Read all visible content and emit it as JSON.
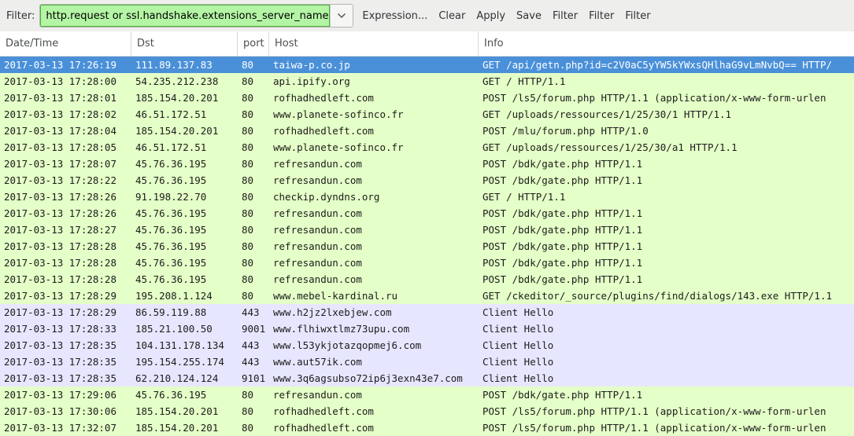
{
  "toolbar": {
    "filter_label": "Filter:",
    "filter_value": "http.request or ssl.handshake.extensions_server_name",
    "buttons": [
      "Expression...",
      "Clear",
      "Apply",
      "Save",
      "Filter",
      "Filter",
      "Filter"
    ]
  },
  "columns": [
    "Date/Time",
    "Dst",
    "port",
    "Host",
    "Info"
  ],
  "colors": {
    "http": "#e4ffc7",
    "tls": "#e7e6ff",
    "selected": "#4a90d9",
    "filter_valid": "#b4f5a5"
  },
  "packets": [
    {
      "time": "2017-03-13 17:26:19",
      "dst": "111.89.137.83",
      "port": "80",
      "host": "taiwa-p.co.jp",
      "info": "GET /api/getn.php?id=c2V0aC5yYW5kYWxsQHlhaG9vLmNvbQ== HTTP/",
      "proto": "http",
      "selected": true
    },
    {
      "time": "2017-03-13 17:28:00",
      "dst": "54.235.212.238",
      "port": "80",
      "host": "api.ipify.org",
      "info": "GET / HTTP/1.1",
      "proto": "http"
    },
    {
      "time": "2017-03-13 17:28:01",
      "dst": "185.154.20.201",
      "port": "80",
      "host": "rofhadhedleft.com",
      "info": "POST /ls5/forum.php HTTP/1.1  (application/x-www-form-urlen",
      "proto": "http"
    },
    {
      "time": "2017-03-13 17:28:02",
      "dst": "46.51.172.51",
      "port": "80",
      "host": "www.planete-sofinco.fr",
      "info": "GET /uploads/ressources/1/25/30/1 HTTP/1.1",
      "proto": "http"
    },
    {
      "time": "2017-03-13 17:28:04",
      "dst": "185.154.20.201",
      "port": "80",
      "host": "rofhadhedleft.com",
      "info": "POST /mlu/forum.php HTTP/1.0",
      "proto": "http"
    },
    {
      "time": "2017-03-13 17:28:05",
      "dst": "46.51.172.51",
      "port": "80",
      "host": "www.planete-sofinco.fr",
      "info": "GET /uploads/ressources/1/25/30/a1 HTTP/1.1",
      "proto": "http"
    },
    {
      "time": "2017-03-13 17:28:07",
      "dst": "45.76.36.195",
      "port": "80",
      "host": "refresandun.com",
      "info": "POST /bdk/gate.php HTTP/1.1",
      "proto": "http"
    },
    {
      "time": "2017-03-13 17:28:22",
      "dst": "45.76.36.195",
      "port": "80",
      "host": "refresandun.com",
      "info": "POST /bdk/gate.php HTTP/1.1",
      "proto": "http"
    },
    {
      "time": "2017-03-13 17:28:26",
      "dst": "91.198.22.70",
      "port": "80",
      "host": "checkip.dyndns.org",
      "info": "GET / HTTP/1.1",
      "proto": "http"
    },
    {
      "time": "2017-03-13 17:28:26",
      "dst": "45.76.36.195",
      "port": "80",
      "host": "refresandun.com",
      "info": "POST /bdk/gate.php HTTP/1.1",
      "proto": "http"
    },
    {
      "time": "2017-03-13 17:28:27",
      "dst": "45.76.36.195",
      "port": "80",
      "host": "refresandun.com",
      "info": "POST /bdk/gate.php HTTP/1.1",
      "proto": "http"
    },
    {
      "time": "2017-03-13 17:28:28",
      "dst": "45.76.36.195",
      "port": "80",
      "host": "refresandun.com",
      "info": "POST /bdk/gate.php HTTP/1.1",
      "proto": "http"
    },
    {
      "time": "2017-03-13 17:28:28",
      "dst": "45.76.36.195",
      "port": "80",
      "host": "refresandun.com",
      "info": "POST /bdk/gate.php HTTP/1.1",
      "proto": "http"
    },
    {
      "time": "2017-03-13 17:28:28",
      "dst": "45.76.36.195",
      "port": "80",
      "host": "refresandun.com",
      "info": "POST /bdk/gate.php HTTP/1.1",
      "proto": "http"
    },
    {
      "time": "2017-03-13 17:28:29",
      "dst": "195.208.1.124",
      "port": "80",
      "host": "www.mebel-kardinal.ru",
      "info": "GET /ckeditor/_source/plugins/find/dialogs/143.exe HTTP/1.1",
      "proto": "http"
    },
    {
      "time": "2017-03-13 17:28:29",
      "dst": "86.59.119.88",
      "port": "443",
      "host": "www.h2jz2lxebjew.com",
      "info": "Client Hello",
      "proto": "tls"
    },
    {
      "time": "2017-03-13 17:28:33",
      "dst": "185.21.100.50",
      "port": "9001",
      "host": "www.flhiwxtlmz73upu.com",
      "info": "Client Hello",
      "proto": "tls"
    },
    {
      "time": "2017-03-13 17:28:35",
      "dst": "104.131.178.134",
      "port": "443",
      "host": "www.l53ykjotazqopmej6.com",
      "info": "Client Hello",
      "proto": "tls"
    },
    {
      "time": "2017-03-13 17:28:35",
      "dst": "195.154.255.174",
      "port": "443",
      "host": "www.aut57ik.com",
      "info": "Client Hello",
      "proto": "tls"
    },
    {
      "time": "2017-03-13 17:28:35",
      "dst": "62.210.124.124",
      "port": "9101",
      "host": "www.3q6agsubso72ip6j3exn43e7.com",
      "info": "Client Hello",
      "proto": "tls"
    },
    {
      "time": "2017-03-13 17:29:06",
      "dst": "45.76.36.195",
      "port": "80",
      "host": "refresandun.com",
      "info": "POST /bdk/gate.php HTTP/1.1",
      "proto": "http"
    },
    {
      "time": "2017-03-13 17:30:06",
      "dst": "185.154.20.201",
      "port": "80",
      "host": "rofhadhedleft.com",
      "info": "POST /ls5/forum.php HTTP/1.1  (application/x-www-form-urlen",
      "proto": "http"
    },
    {
      "time": "2017-03-13 17:32:07",
      "dst": "185.154.20.201",
      "port": "80",
      "host": "rofhadhedleft.com",
      "info": "POST /ls5/forum.php HTTP/1.1  (application/x-www-form-urlen",
      "proto": "http"
    }
  ]
}
